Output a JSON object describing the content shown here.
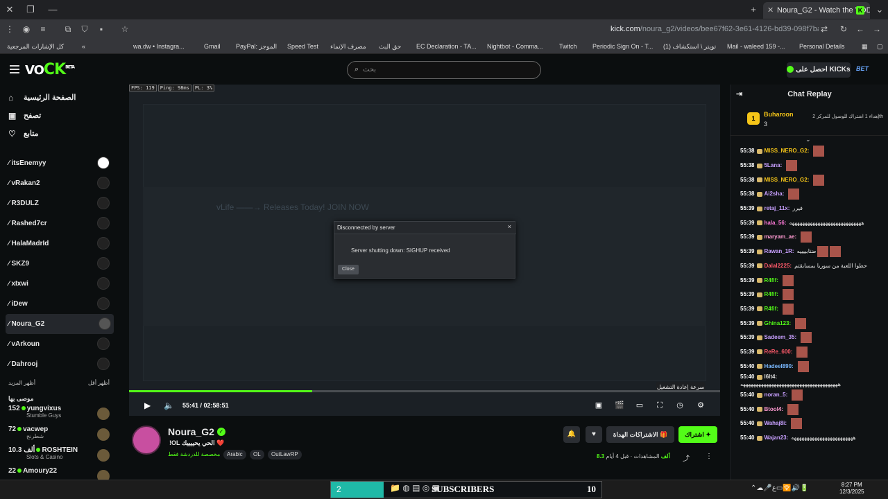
{
  "browser": {
    "tab_title": "Noura_G2 - Watch the VOD on",
    "url_domain": "kick.com",
    "url_path": "/noura_g2/videos/bee67f62-3e61-4126-bd39-098f7ba5baba",
    "bookmarks": [
      "كل الإشارات المرجعية",
      "wa.dw • Instagra...",
      "Gmail",
      "PayPal: الموجز",
      "Speed Test",
      "مصرف الإنماء",
      "حق البث",
      "EC Declaration - TA...",
      "Nightbot - Comma...",
      "Twitch",
      "Periodic Sign On - T...",
      "(1) تويتر \\ استكشاف",
      "Mail - waleed 159 -...",
      "Personal Details"
    ]
  },
  "header": {
    "logo": "KICK",
    "logo_badge": "BETA",
    "search_placeholder": "بحث",
    "get_kicks": "احصل على KICKs",
    "bet": "BET"
  },
  "sidebar": {
    "nav": [
      {
        "label": "الصفحة الرئيسية",
        "icon": "home-icon"
      },
      {
        "label": "تصفح",
        "icon": "browse-icon"
      },
      {
        "label": "متابع",
        "icon": "heart-icon"
      }
    ],
    "channels": [
      "itsEnemyy",
      "vRakan2",
      "R3DULZ",
      "Rashed7cr",
      "HalaMadrId",
      "SKZ9",
      "xIxwi",
      "iDew",
      "Noura_G2",
      "vArkoun",
      "Dahrooj"
    ],
    "show_less": "أظهر أقل",
    "show_more": "أظهر المزيد",
    "recommended_title": "موصى بها",
    "recommended": [
      {
        "count": "152",
        "name": "yungvixus",
        "game": "Stumble Guys"
      },
      {
        "count": "72",
        "name": "vacwep",
        "game": "شطرنج"
      },
      {
        "count": "10.3 ألف",
        "name": "ROSHTEIN",
        "game": "Slots & Casino"
      },
      {
        "count": "22",
        "name": "Amoury22",
        "game": ""
      }
    ]
  },
  "player": {
    "stats": {
      "fps": "FPS: 119",
      "ping": "Ping: 98ms",
      "pl": "PL: 3%"
    },
    "bg_text": "vLife ——→ Releases Today! JOIN NOW",
    "dialog": {
      "title": "Disconnected by server",
      "message": "Server shutting down: SIGHUP received",
      "close_label": "Close",
      "close_x": "×"
    },
    "progress": 0.31,
    "current_time": "55:41",
    "duration": "02:58:51",
    "tooltip": "سرعة إعادة التشغيل"
  },
  "channel": {
    "name": "Noura_G2",
    "title": "!OL   الحي يحييييك ❤️",
    "sub": "مخصصة للدردشة فقط",
    "tags": [
      "Arabic",
      "OL",
      "OutLawRP"
    ],
    "gift_subs": "الاشتراكات الهداة",
    "subscribe": "اشتراك",
    "viewers_value": "8.3 ألف",
    "viewers_label": "المشاهدات",
    "age": "قبل 4 أيام"
  },
  "chat": {
    "title": "Chat Replay",
    "pinned": {
      "rank": "1",
      "name": "Buharoon",
      "count": "3",
      "gift": "إهداء 1 اشتراك للوصول للمركز 2th"
    },
    "messages": [
      {
        "t": "55:38",
        "u": "MISS_NERO_G2:",
        "c": "#f5c518",
        "text": "",
        "e": 1
      },
      {
        "t": "55:38",
        "u": "5Lana:",
        "c": "#c8a0ff",
        "text": "",
        "e": 1
      },
      {
        "t": "55:38",
        "u": "MISS_NERO_G2:",
        "c": "#f5c518",
        "text": "",
        "e": 1
      },
      {
        "t": "55:38",
        "u": "Ai2sha:",
        "c": "#c8a0ff",
        "text": "",
        "e": 1
      },
      {
        "t": "55:39",
        "u": "retaj_11x:",
        "c": "#c8a0ff",
        "text": "فيرر",
        "e": 0
      },
      {
        "t": "55:39",
        "u": "hala_56:",
        "c": "#ff7ad9",
        "text": "ههههههههههههههههههههههههههههه",
        "e": 0
      },
      {
        "t": "55:39",
        "u": "maryam_ae:",
        "c": "#ff9bd2",
        "text": "",
        "e": 1
      },
      {
        "t": "55:39",
        "u": "Rawan_1R:",
        "c": "#c8a0ff",
        "text": "ضتابييييه",
        "e": 2
      },
      {
        "t": "55:39",
        "u": "Dalal2225:",
        "c": "#ff5a6a",
        "text": "حطوا اللعبة من سوريا بمسابقتم",
        "e": 0
      },
      {
        "t": "55:39",
        "u": "R4fif:",
        "c": "#53fc18",
        "text": "",
        "e": 1
      },
      {
        "t": "55:39",
        "u": "R4fif:",
        "c": "#53fc18",
        "text": "",
        "e": 1
      },
      {
        "t": "55:39",
        "u": "R4fif:",
        "c": "#53fc18",
        "text": "",
        "e": 1
      },
      {
        "t": "55:39",
        "u": "Ghina123:",
        "c": "#53fc18",
        "text": "",
        "e": 1
      },
      {
        "t": "55:39",
        "u": "Sadeem_35:",
        "c": "#c8a0ff",
        "text": "",
        "e": 1
      },
      {
        "t": "55:39",
        "u": "ReRe_600:",
        "c": "#ff5a6a",
        "text": "",
        "e": 1
      },
      {
        "t": "55:40",
        "u": "Hadeel890:",
        "c": "#7ab8ff",
        "text": "",
        "e": 1
      },
      {
        "t": "55:40",
        "u": "l6lt4:",
        "c": "#ddd",
        "text": "ههههههههههههههههههههههههههههههههههههههه",
        "e": 0
      },
      {
        "t": "55:40",
        "u": "noran_5:",
        "c": "#c8a0ff",
        "text": "",
        "e": 1
      },
      {
        "t": "55:40",
        "u": "Btool4:",
        "c": "#ff9bd2",
        "text": "",
        "e": 1
      },
      {
        "t": "55:40",
        "u": "Wahaj8i:",
        "c": "#c8a0ff",
        "text": "",
        "e": 1
      },
      {
        "t": "55:40",
        "u": "Wajan23:",
        "c": "#c8a0ff",
        "text": "ههههههههههههههههههههههههه",
        "e": 0
      }
    ]
  },
  "taskbar": {
    "counter_left": "2",
    "subscribers": "SUBSCRIBERS",
    "counter_right": "10",
    "time": "8:27 PM",
    "date": "12/3/2025"
  }
}
